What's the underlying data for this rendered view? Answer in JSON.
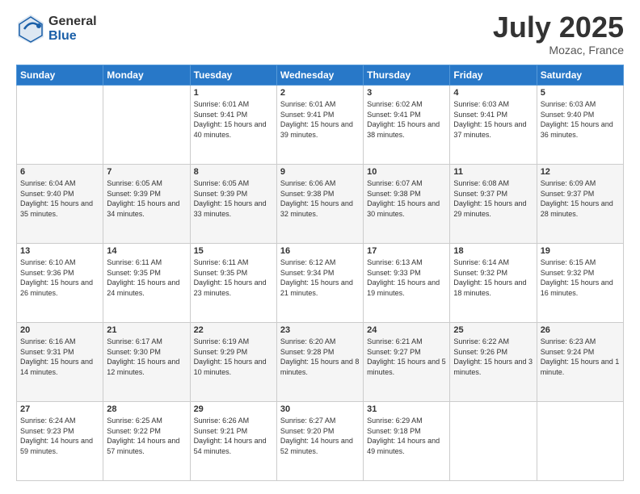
{
  "header": {
    "logo_general": "General",
    "logo_blue": "Blue",
    "title": "July 2025",
    "location": "Mozac, France"
  },
  "weekdays": [
    "Sunday",
    "Monday",
    "Tuesday",
    "Wednesday",
    "Thursday",
    "Friday",
    "Saturday"
  ],
  "weeks": [
    [
      {
        "day": "",
        "info": ""
      },
      {
        "day": "",
        "info": ""
      },
      {
        "day": "1",
        "info": "Sunrise: 6:01 AM\nSunset: 9:41 PM\nDaylight: 15 hours and 40 minutes."
      },
      {
        "day": "2",
        "info": "Sunrise: 6:01 AM\nSunset: 9:41 PM\nDaylight: 15 hours and 39 minutes."
      },
      {
        "day": "3",
        "info": "Sunrise: 6:02 AM\nSunset: 9:41 PM\nDaylight: 15 hours and 38 minutes."
      },
      {
        "day": "4",
        "info": "Sunrise: 6:03 AM\nSunset: 9:41 PM\nDaylight: 15 hours and 37 minutes."
      },
      {
        "day": "5",
        "info": "Sunrise: 6:03 AM\nSunset: 9:40 PM\nDaylight: 15 hours and 36 minutes."
      }
    ],
    [
      {
        "day": "6",
        "info": "Sunrise: 6:04 AM\nSunset: 9:40 PM\nDaylight: 15 hours and 35 minutes."
      },
      {
        "day": "7",
        "info": "Sunrise: 6:05 AM\nSunset: 9:39 PM\nDaylight: 15 hours and 34 minutes."
      },
      {
        "day": "8",
        "info": "Sunrise: 6:05 AM\nSunset: 9:39 PM\nDaylight: 15 hours and 33 minutes."
      },
      {
        "day": "9",
        "info": "Sunrise: 6:06 AM\nSunset: 9:38 PM\nDaylight: 15 hours and 32 minutes."
      },
      {
        "day": "10",
        "info": "Sunrise: 6:07 AM\nSunset: 9:38 PM\nDaylight: 15 hours and 30 minutes."
      },
      {
        "day": "11",
        "info": "Sunrise: 6:08 AM\nSunset: 9:37 PM\nDaylight: 15 hours and 29 minutes."
      },
      {
        "day": "12",
        "info": "Sunrise: 6:09 AM\nSunset: 9:37 PM\nDaylight: 15 hours and 28 minutes."
      }
    ],
    [
      {
        "day": "13",
        "info": "Sunrise: 6:10 AM\nSunset: 9:36 PM\nDaylight: 15 hours and 26 minutes."
      },
      {
        "day": "14",
        "info": "Sunrise: 6:11 AM\nSunset: 9:35 PM\nDaylight: 15 hours and 24 minutes."
      },
      {
        "day": "15",
        "info": "Sunrise: 6:11 AM\nSunset: 9:35 PM\nDaylight: 15 hours and 23 minutes."
      },
      {
        "day": "16",
        "info": "Sunrise: 6:12 AM\nSunset: 9:34 PM\nDaylight: 15 hours and 21 minutes."
      },
      {
        "day": "17",
        "info": "Sunrise: 6:13 AM\nSunset: 9:33 PM\nDaylight: 15 hours and 19 minutes."
      },
      {
        "day": "18",
        "info": "Sunrise: 6:14 AM\nSunset: 9:32 PM\nDaylight: 15 hours and 18 minutes."
      },
      {
        "day": "19",
        "info": "Sunrise: 6:15 AM\nSunset: 9:32 PM\nDaylight: 15 hours and 16 minutes."
      }
    ],
    [
      {
        "day": "20",
        "info": "Sunrise: 6:16 AM\nSunset: 9:31 PM\nDaylight: 15 hours and 14 minutes."
      },
      {
        "day": "21",
        "info": "Sunrise: 6:17 AM\nSunset: 9:30 PM\nDaylight: 15 hours and 12 minutes."
      },
      {
        "day": "22",
        "info": "Sunrise: 6:19 AM\nSunset: 9:29 PM\nDaylight: 15 hours and 10 minutes."
      },
      {
        "day": "23",
        "info": "Sunrise: 6:20 AM\nSunset: 9:28 PM\nDaylight: 15 hours and 8 minutes."
      },
      {
        "day": "24",
        "info": "Sunrise: 6:21 AM\nSunset: 9:27 PM\nDaylight: 15 hours and 5 minutes."
      },
      {
        "day": "25",
        "info": "Sunrise: 6:22 AM\nSunset: 9:26 PM\nDaylight: 15 hours and 3 minutes."
      },
      {
        "day": "26",
        "info": "Sunrise: 6:23 AM\nSunset: 9:24 PM\nDaylight: 15 hours and 1 minute."
      }
    ],
    [
      {
        "day": "27",
        "info": "Sunrise: 6:24 AM\nSunset: 9:23 PM\nDaylight: 14 hours and 59 minutes."
      },
      {
        "day": "28",
        "info": "Sunrise: 6:25 AM\nSunset: 9:22 PM\nDaylight: 14 hours and 57 minutes."
      },
      {
        "day": "29",
        "info": "Sunrise: 6:26 AM\nSunset: 9:21 PM\nDaylight: 14 hours and 54 minutes."
      },
      {
        "day": "30",
        "info": "Sunrise: 6:27 AM\nSunset: 9:20 PM\nDaylight: 14 hours and 52 minutes."
      },
      {
        "day": "31",
        "info": "Sunrise: 6:29 AM\nSunset: 9:18 PM\nDaylight: 14 hours and 49 minutes."
      },
      {
        "day": "",
        "info": ""
      },
      {
        "day": "",
        "info": ""
      }
    ]
  ]
}
